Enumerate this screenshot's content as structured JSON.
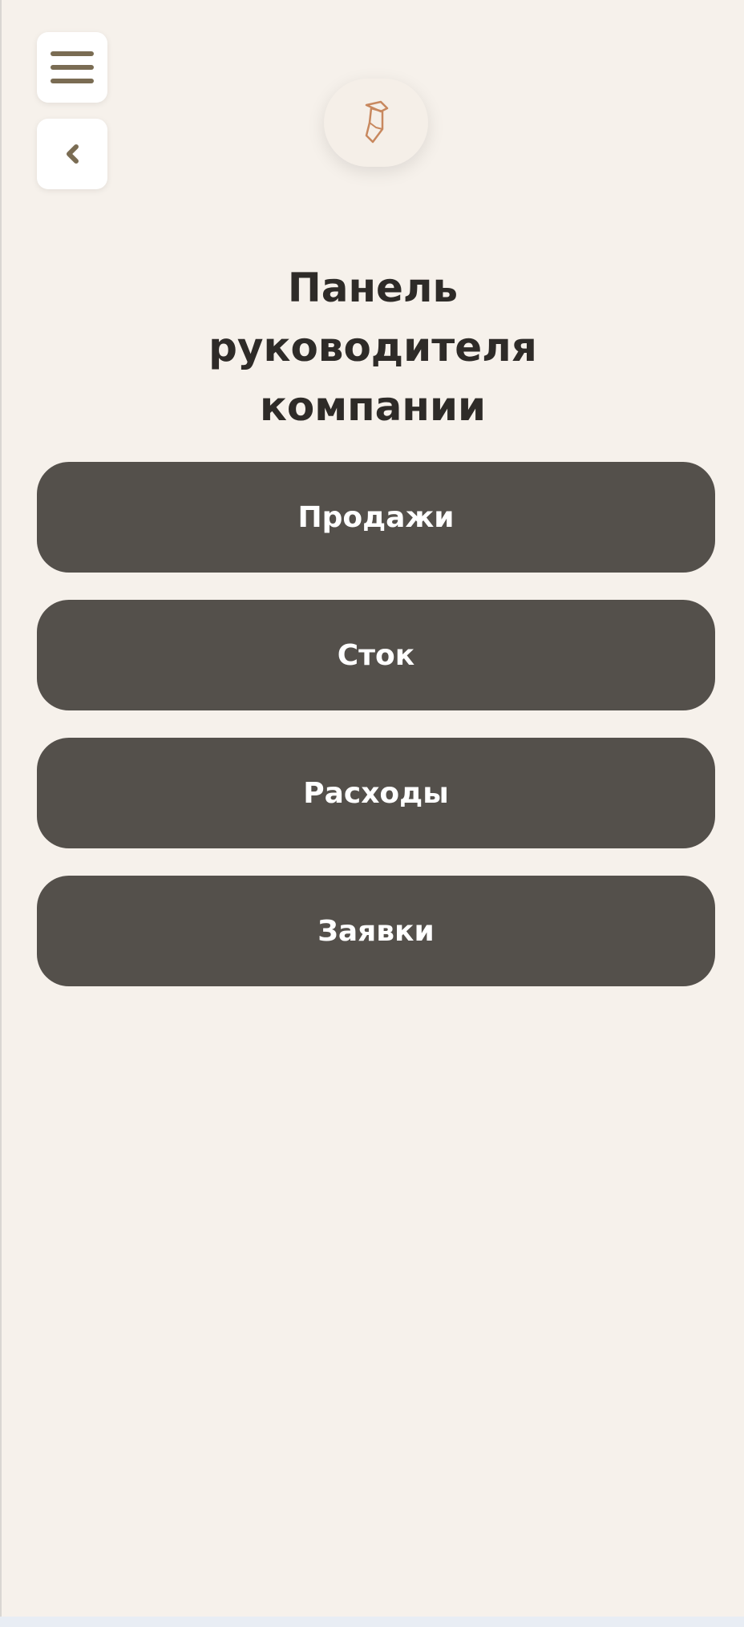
{
  "header": {
    "menu_icon": "hamburger-menu-icon",
    "back_icon": "chevron-left-icon",
    "logo_icon": "brand-logo-icon"
  },
  "title": "Панель руководителя компании",
  "menu": [
    {
      "label": "Продажи"
    },
    {
      "label": "Сток"
    },
    {
      "label": "Расходы"
    },
    {
      "label": "Заявки"
    }
  ],
  "colors": {
    "background": "#f6f1eb",
    "button": "#54504b",
    "button_text": "#ffffff",
    "accent": "#7a6c53",
    "logo_stroke": "#c8885e"
  }
}
